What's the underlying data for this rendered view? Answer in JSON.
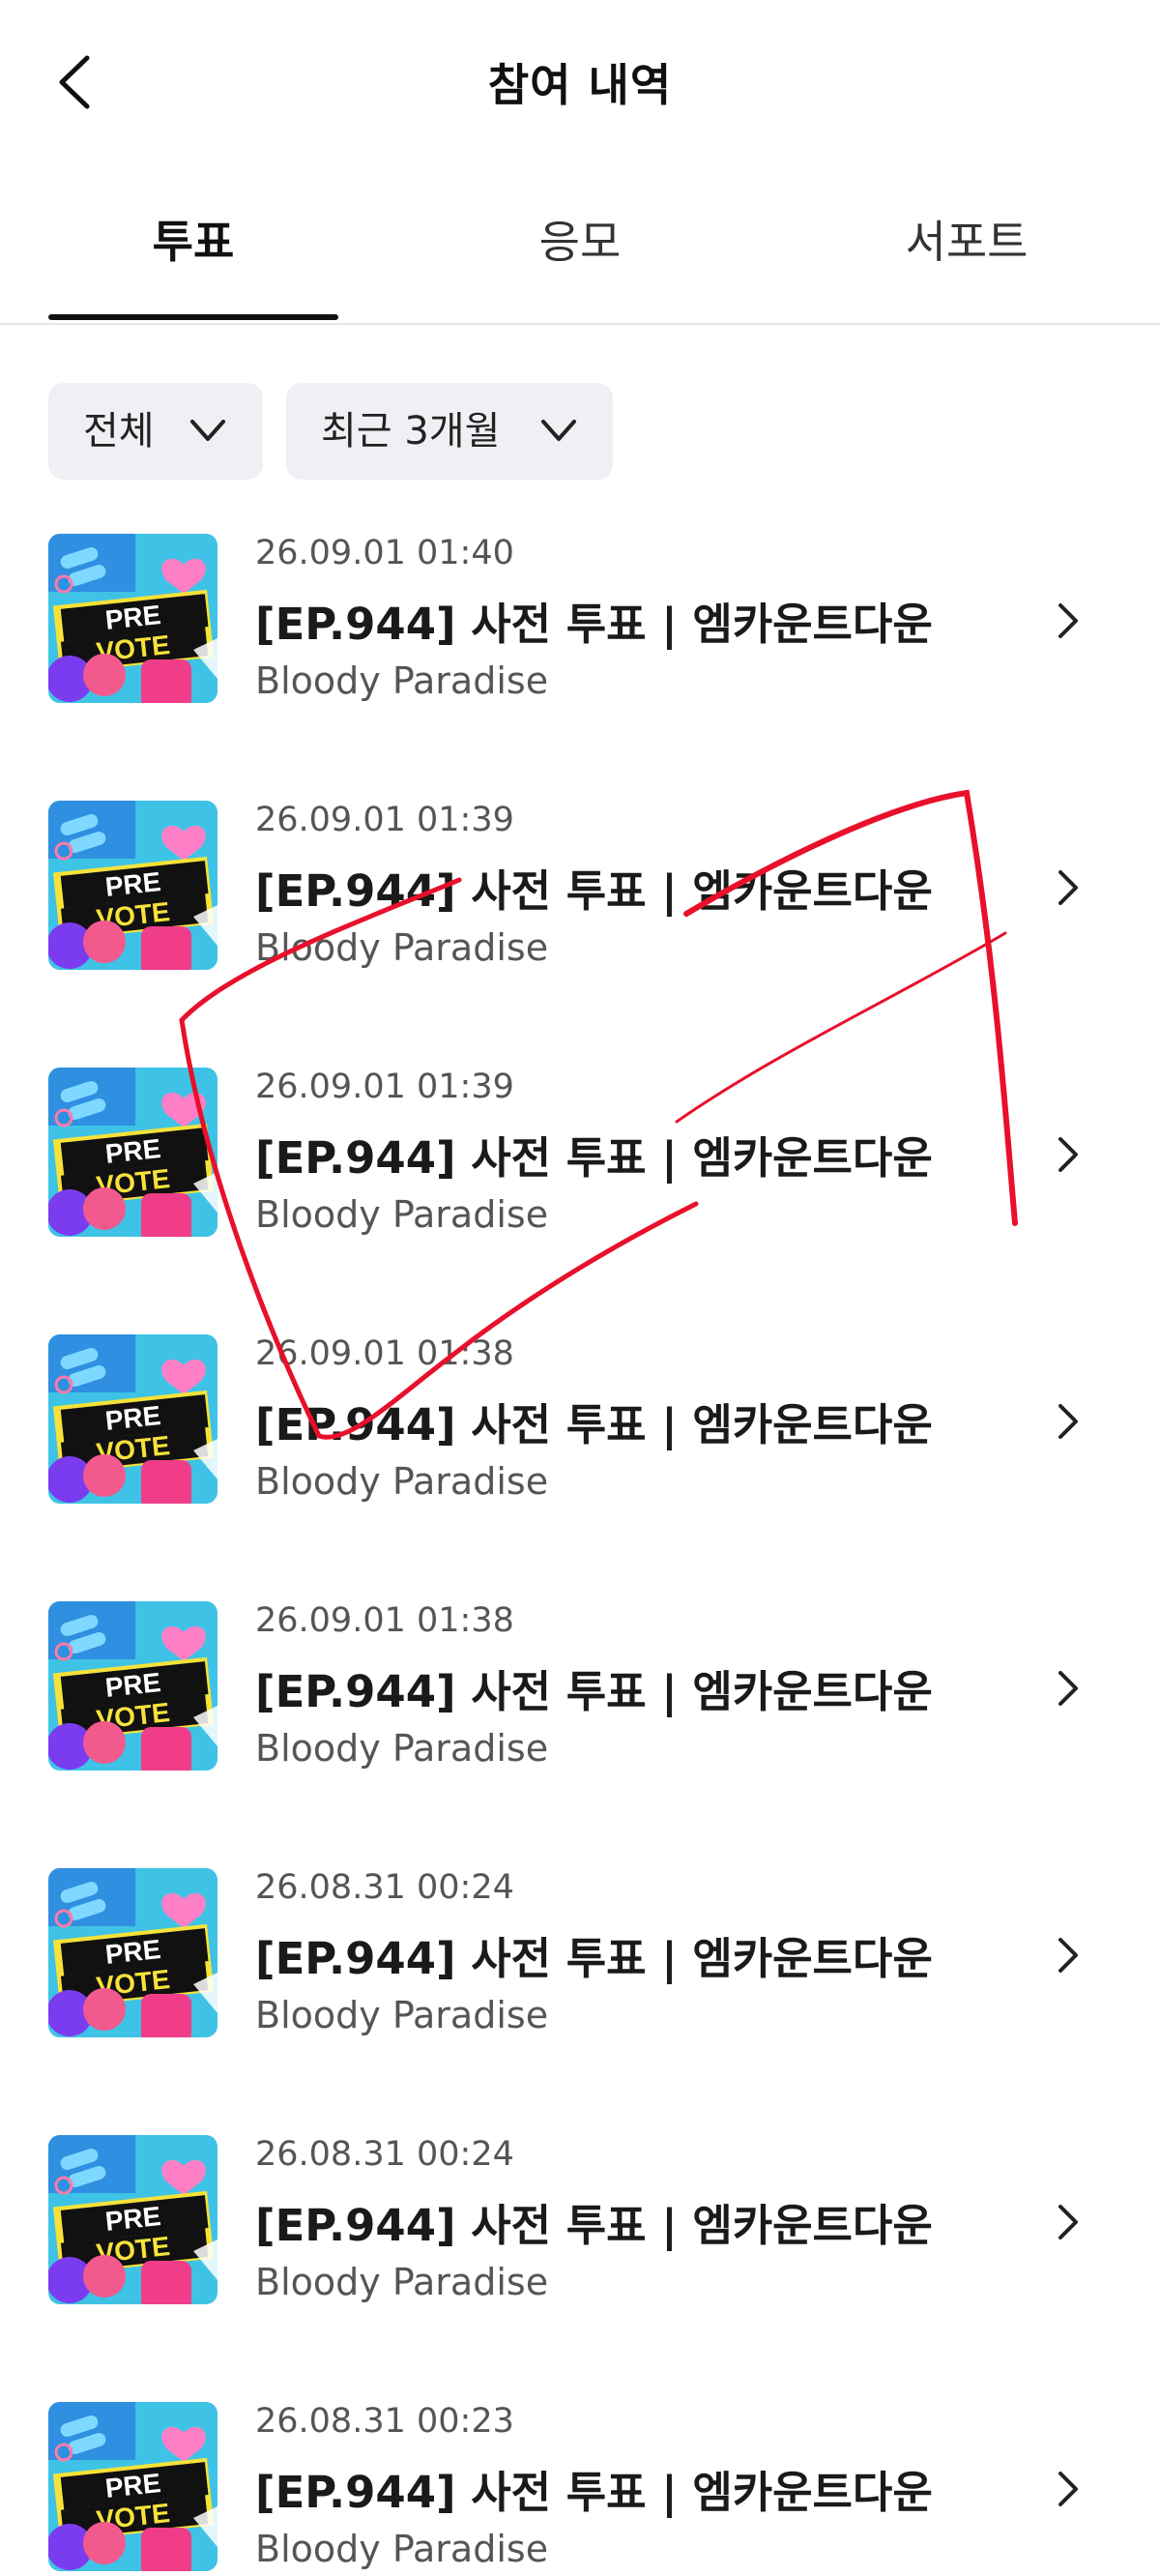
{
  "header": {
    "title": "참여 내역"
  },
  "tabs": [
    {
      "label": "투표",
      "active": true
    },
    {
      "label": "응모",
      "active": false
    },
    {
      "label": "서포트",
      "active": false
    }
  ],
  "filters": {
    "type_label": "전체",
    "period_label": "최근 3개월"
  },
  "thumbnail": {
    "line1": "PRE",
    "line2": "VOTE"
  },
  "items": [
    {
      "date": "26.09.01 01:40",
      "title": "[EP.944] 사전 투표 | 엠카운트다운",
      "subtitle": "Bloody Paradise"
    },
    {
      "date": "26.09.01 01:39",
      "title": "[EP.944] 사전 투표 | 엠카운트다운",
      "subtitle": "Bloody Paradise"
    },
    {
      "date": "26.09.01 01:39",
      "title": "[EP.944] 사전 투표 | 엠카운트다운",
      "subtitle": "Bloody Paradise"
    },
    {
      "date": "26.09.01 01:38",
      "title": "[EP.944] 사전 투표 | 엠카운트다운",
      "subtitle": "Bloody Paradise"
    },
    {
      "date": "26.09.01 01:38",
      "title": "[EP.944] 사전 투표 | 엠카운트다운",
      "subtitle": "Bloody Paradise"
    },
    {
      "date": "26.08.31 00:24",
      "title": "[EP.944] 사전 투표 | 엠카운트다운",
      "subtitle": "Bloody Paradise"
    },
    {
      "date": "26.08.31 00:24",
      "title": "[EP.944] 사전 투표 | 엠카운트다운",
      "subtitle": "Bloody Paradise"
    },
    {
      "date": "26.08.31 00:23",
      "title": "[EP.944] 사전 투표 | 엠카운트다운",
      "subtitle": "Bloody Paradise"
    }
  ],
  "colors": {
    "annotation": "#e8102a",
    "chip_bg": "#eef0f3",
    "thumb_bg": "#3ec3e6",
    "thumb_banner": "#111111",
    "thumb_yellow": "#f7e23a",
    "thumb_pink": "#f25a8e"
  },
  "icons": {
    "back": "chevron-left-icon",
    "dropdown": "chevron-down-icon",
    "row": "chevron-right-icon"
  }
}
